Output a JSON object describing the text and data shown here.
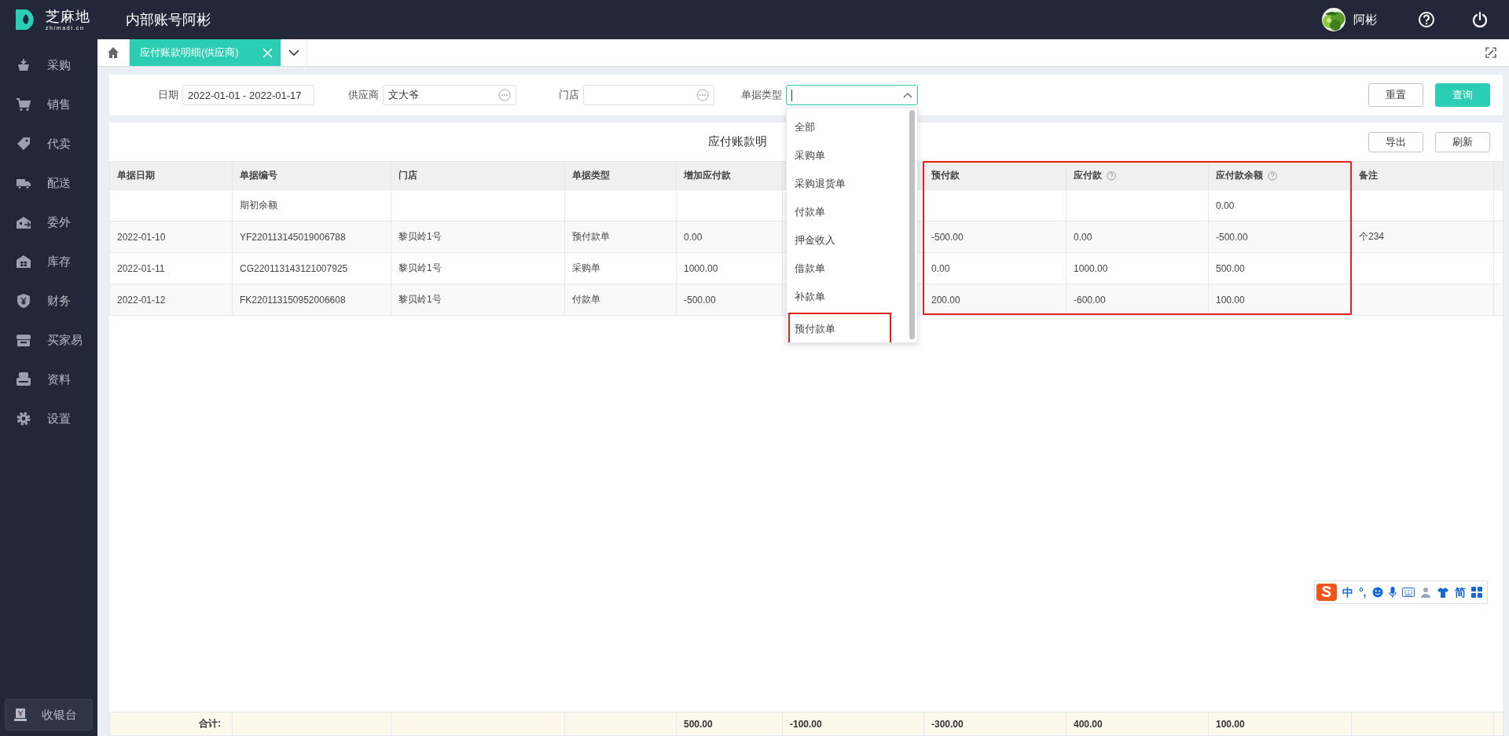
{
  "app": {
    "logo_text": "芝麻地",
    "logo_subtext": "zhimadi.cn",
    "account_title": "内部账号阿彬",
    "user_name": "阿彬"
  },
  "sidebar": {
    "items": [
      {
        "label": "采购"
      },
      {
        "label": "销售"
      },
      {
        "label": "代卖"
      },
      {
        "label": "配送"
      },
      {
        "label": "委外"
      },
      {
        "label": "库存"
      },
      {
        "label": "财务"
      },
      {
        "label": "买家易"
      },
      {
        "label": "资料"
      },
      {
        "label": "设置"
      }
    ],
    "footer_button": "收银台"
  },
  "tabs": [
    {
      "label": "应付账款明细(供应商)",
      "selected": true
    }
  ],
  "filters": [
    {
      "kind": "date",
      "label": "日期",
      "value": "2022-01-01 - 2022-01-17"
    },
    {
      "kind": "picker",
      "label": "供应商",
      "value": "文大爷"
    },
    {
      "kind": "picker",
      "label": "门店"
    },
    {
      "kind": "select",
      "label": "单据类型",
      "expanded": true
    }
  ],
  "filter_buttons": [
    {
      "label": "重置",
      "primary": false
    },
    {
      "label": "查询",
      "primary": true
    }
  ],
  "dropdown": {
    "options": [
      {
        "label": "全部",
        "highlighted": false
      },
      {
        "label": "采购单",
        "highlighted": false
      },
      {
        "label": "采购退货单",
        "highlighted": false
      },
      {
        "label": "付款单",
        "highlighted": false
      },
      {
        "label": "押金收入",
        "highlighted": false
      },
      {
        "label": "借款单",
        "highlighted": false
      },
      {
        "label": "补款单",
        "highlighted": false
      },
      {
        "label": "预付款单",
        "highlighted": true
      }
    ]
  },
  "table": {
    "title": "应付账款明",
    "buttons": [
      "导出",
      "刷新"
    ],
    "columns": [
      {
        "label": "单据日期"
      },
      {
        "label": "单据编号"
      },
      {
        "label": "门店"
      },
      {
        "label": "单据类型"
      },
      {
        "label": "增加应付款"
      },
      {},
      {
        "label": "预付款",
        "highlighted": true
      },
      {
        "label": "应付款",
        "help": true,
        "highlighted": true
      },
      {
        "label": "应付款余额",
        "help": true,
        "highlighted": true
      },
      {
        "label": "备注"
      }
    ],
    "rows": [
      {
        "number": "期初余额",
        "balance": "0.00"
      },
      {
        "date": "2022-01-10",
        "number": "YF220113145019006788",
        "store": "黎贝岭1号",
        "type": "预付款单",
        "increase": "0.00",
        "prepaid": "-500.00",
        "payable": "0.00",
        "balance": "-500.00",
        "note": "个234"
      },
      {
        "date": "2022-01-11",
        "number": "CG220113143121007925",
        "store": "黎贝岭1号",
        "type": "采购单",
        "increase": "1000.00",
        "prepaid": "0.00",
        "payable": "1000.00",
        "balance": "500.00"
      },
      {
        "date": "2022-01-12",
        "number": "FK220113150952006608",
        "store": "黎贝岭1号",
        "type": "付款单",
        "increase": "-500.00",
        "prepaid": "200.00",
        "payable": "-600.00",
        "balance": "100.00"
      }
    ],
    "totals": {
      "date": "合计:",
      "increase": "500.00",
      "column_6": "-100.00",
      "prepaid": "-300.00",
      "payable": "400.00",
      "balance": "100.00"
    }
  },
  "ime_toolbar": {
    "texts": [
      "中",
      "°,",
      "简"
    ]
  }
}
